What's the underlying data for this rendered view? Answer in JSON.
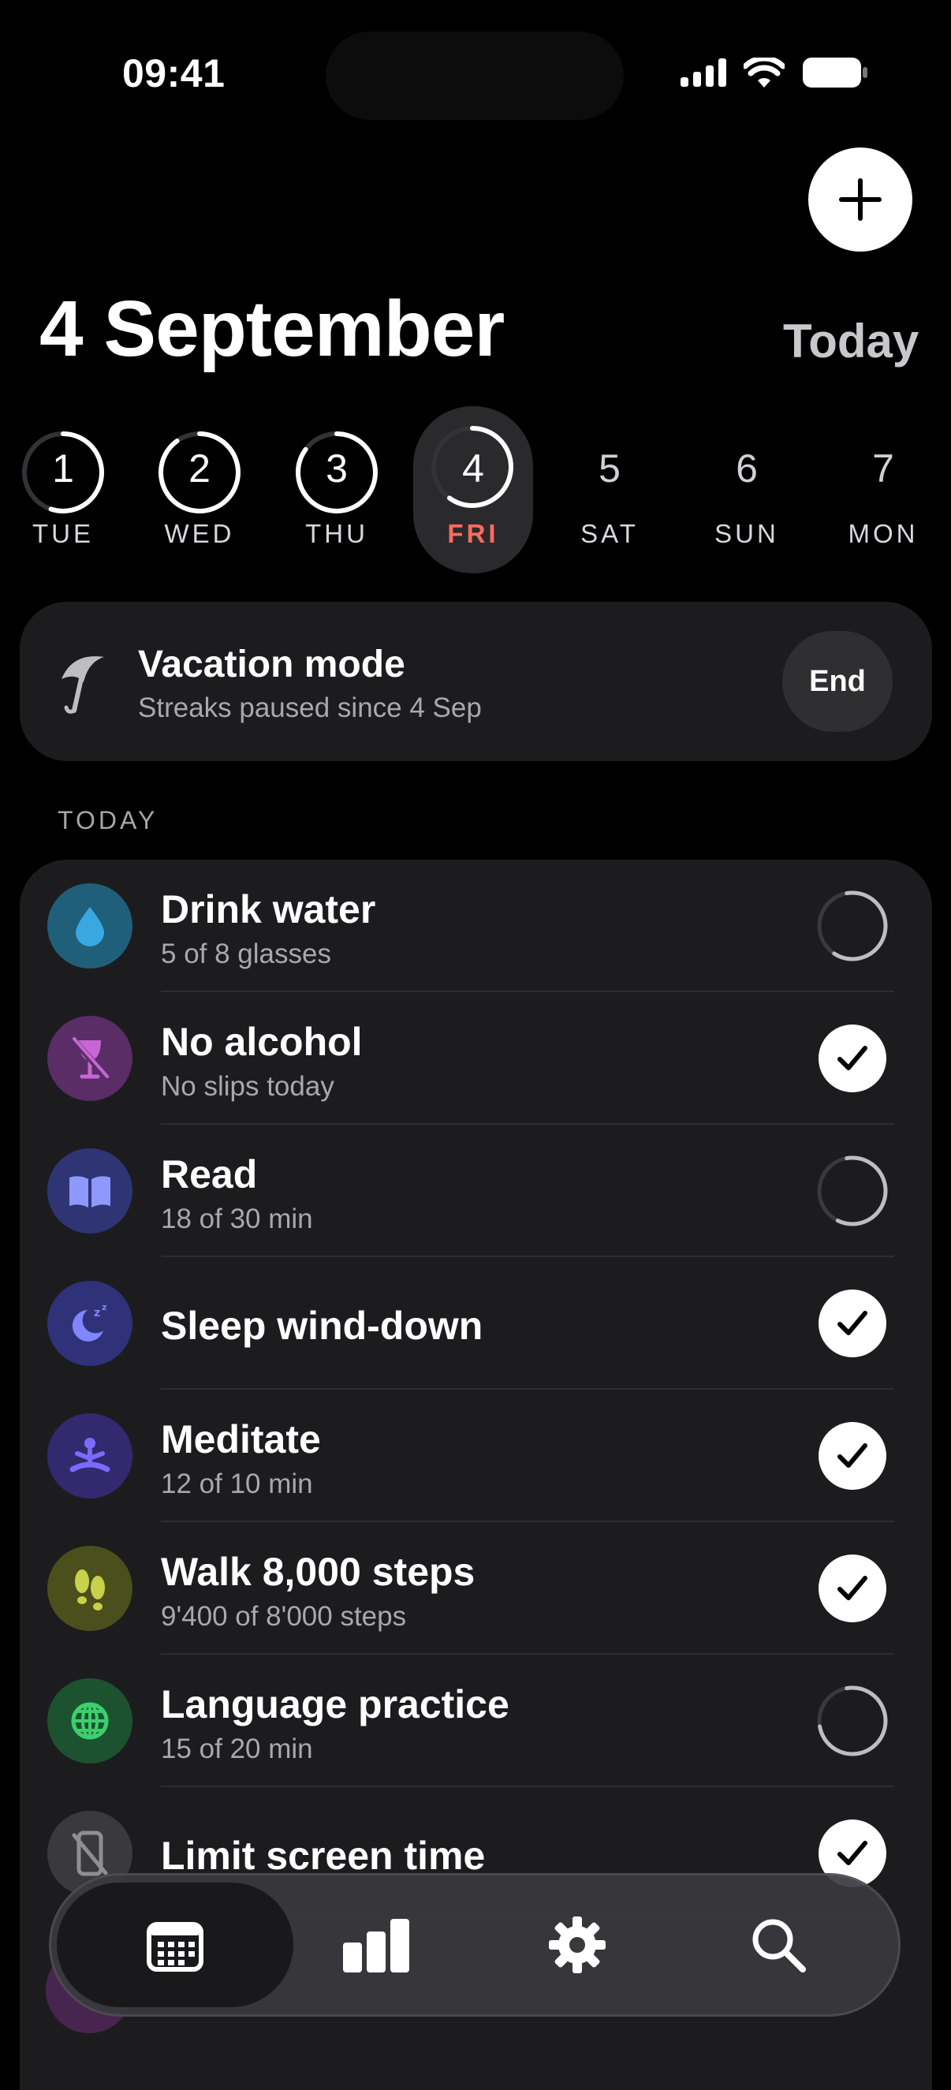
{
  "status_bar": {
    "time": "09:41"
  },
  "header": {
    "title": "4 September",
    "today_label": "Today"
  },
  "week": [
    {
      "num": "1",
      "day": "TUE",
      "progress": 0.55,
      "state": "past"
    },
    {
      "num": "2",
      "day": "WED",
      "progress": 0.9,
      "state": "past"
    },
    {
      "num": "3",
      "day": "THU",
      "progress": 0.85,
      "state": "past"
    },
    {
      "num": "4",
      "day": "FRI",
      "progress": 0.6,
      "state": "selected"
    },
    {
      "num": "5",
      "day": "SAT",
      "state": "future"
    },
    {
      "num": "6",
      "day": "SUN",
      "state": "future"
    },
    {
      "num": "7",
      "day": "MON",
      "state": "future"
    }
  ],
  "vacation": {
    "title": "Vacation mode",
    "subtitle": "Streaks paused since 4 Sep",
    "end_label": "End"
  },
  "section_label": "TODAY",
  "habits": [
    {
      "name": "Drink water",
      "sub": "5 of 8 glasses",
      "icon": "water-drop-icon",
      "color": "#1f5f7a",
      "done": false,
      "progress": 0.62
    },
    {
      "name": "No alcohol",
      "sub": "No slips today",
      "icon": "no-alcohol-icon",
      "color": "#5a2d66",
      "done": true
    },
    {
      "name": "Read",
      "sub": "18 of 30 min",
      "icon": "book-icon",
      "color": "#2f3474",
      "done": false,
      "progress": 0.6
    },
    {
      "name": "Sleep wind-down",
      "sub": "",
      "icon": "moon-sleep-icon",
      "color": "#2f3278",
      "done": true
    },
    {
      "name": "Meditate",
      "sub": "12 of 10 min",
      "icon": "meditate-icon",
      "color": "#33296e",
      "done": true
    },
    {
      "name": "Walk 8,000 steps",
      "sub": "9'400 of 8'000 steps",
      "icon": "footsteps-icon",
      "color": "#4a4f1c",
      "done": true
    },
    {
      "name": "Language practice",
      "sub": "15 of 20 min",
      "icon": "globe-icon",
      "color": "#1d5231",
      "done": false,
      "progress": 0.75
    },
    {
      "name": "Limit screen time",
      "sub": "",
      "icon": "no-phone-icon",
      "color": "#3a3a3e",
      "done": true
    }
  ],
  "tabbar": [
    "calendar-icon",
    "stats-icon",
    "gear-icon",
    "search-icon"
  ]
}
